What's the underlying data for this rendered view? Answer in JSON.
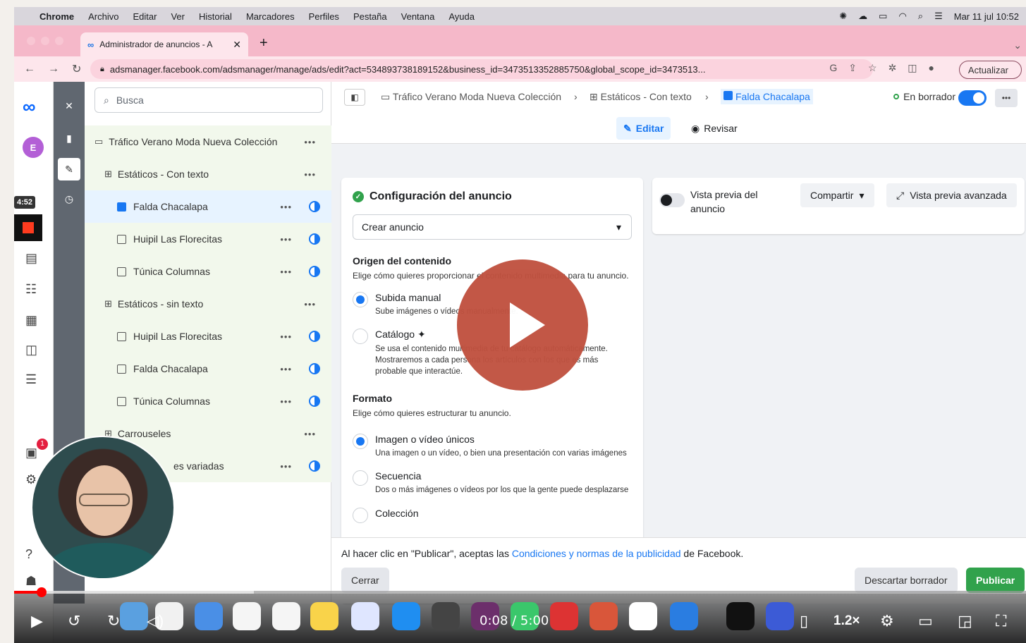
{
  "menubar": {
    "app": "Chrome",
    "items": [
      "Archivo",
      "Editar",
      "Ver",
      "Historial",
      "Marcadores",
      "Perfiles",
      "Pestaña",
      "Ventana",
      "Ayuda"
    ],
    "datetime": "Mar 11 jul 10:52"
  },
  "browser": {
    "tab_title": "Administrador de anuncios - A",
    "url": "adsmanager.facebook.com/adsmanager/manage/ads/edit?act=534893738189152&business_id=3473513352885750&global_scope_id=3473513...",
    "update_label": "Actualizar"
  },
  "rail": {
    "avatar_letter": "E",
    "time_badge": "4:52",
    "notif_count": "1"
  },
  "tree": {
    "search_placeholder": "Busca",
    "campaign": "Tráfico Verano Moda Nueva Colección",
    "set1": "Estáticos - Con texto",
    "set1_ads": [
      "Falda Chacalapa",
      "Huipil Las Florecitas",
      "Túnica Columnas"
    ],
    "set2": "Estáticos - sin texto",
    "set2_ads": [
      "Huipil Las Florecitas",
      "Falda Chacalapa",
      "Túnica Columnas"
    ],
    "set3": "Carrouseles",
    "set3_ad": "es variadas"
  },
  "topbar": {
    "crumb_campaign": "Tráfico Verano Moda Nueva Colección",
    "crumb_set": "Estáticos - Con texto",
    "crumb_ad": "Falda Chacalapa",
    "status": "En borrador",
    "edit_label": "Editar",
    "review_label": "Revisar"
  },
  "form": {
    "title": "Configuración del anuncio",
    "select_value": "Crear anuncio",
    "origin_title": "Origen del contenido",
    "origin_desc": "Elige cómo quieres proporcionar el contenido multimedia para tu anuncio.",
    "opt_manual": "Subida manual",
    "opt_manual_desc": "Sube imágenes o vídeos manualmente.",
    "opt_catalog": "Catálogo",
    "opt_catalog_desc": "Se usa el contenido multimedia de tu catálogo automáticamente. Mostraremos a cada persona los artículos con los que es más probable que interactúe.",
    "format_title": "Formato",
    "format_desc": "Elige cómo quieres estructurar tu anuncio.",
    "fmt_single": "Imagen o vídeo únicos",
    "fmt_single_desc": "Una imagen o un vídeo, o bien una presentación con varias imágenes",
    "fmt_seq": "Secuencia",
    "fmt_seq_desc": "Dos o más imágenes o vídeos por los que la gente puede desplazarse",
    "fmt_coll": "Colección"
  },
  "preview": {
    "label": "Vista previa del anuncio",
    "share": "Compartir",
    "advanced": "Vista previa avanzada"
  },
  "footer": {
    "terms_pre": "Al hacer clic en \"Publicar\", aceptas las ",
    "terms_link": "Condiciones y normas de la publicidad",
    "terms_post": " de Facebook.",
    "close": "Cerrar",
    "discard": "Descartar borrador",
    "publish": "Publicar"
  },
  "player": {
    "time": "0:08 / 5:00",
    "speed": "1.2×",
    "progress": 0.027
  }
}
